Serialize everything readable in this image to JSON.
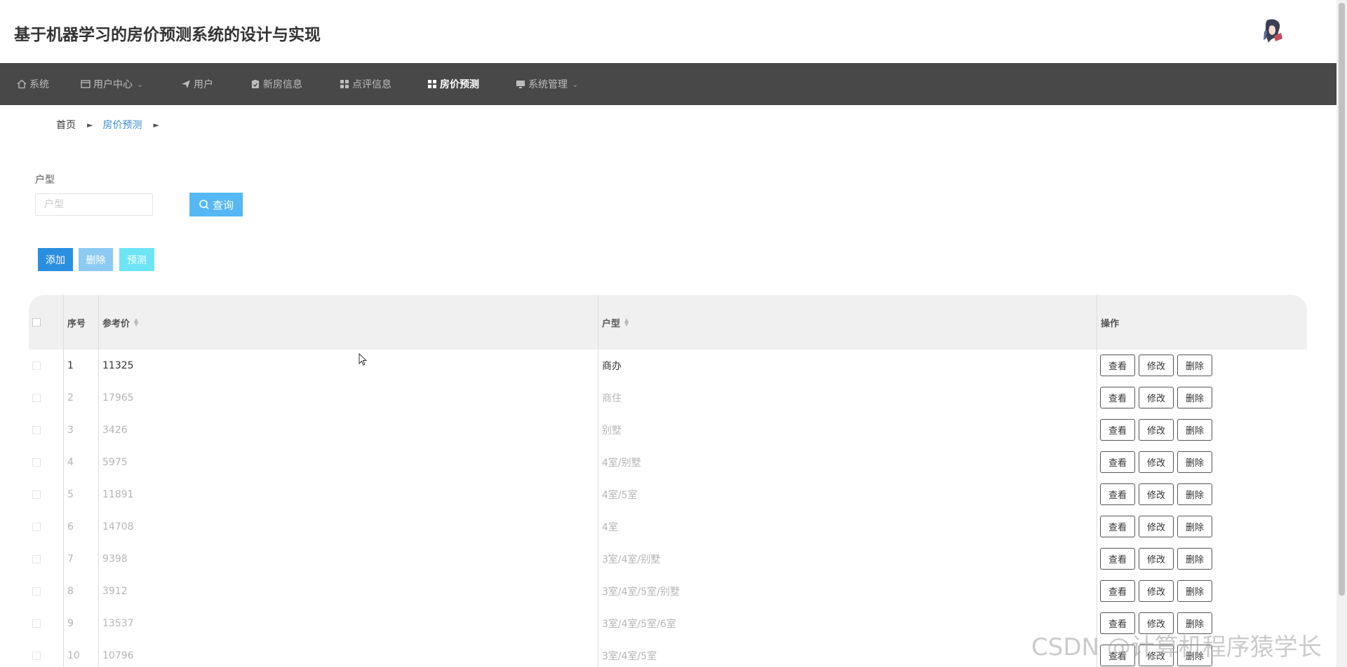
{
  "app": {
    "title": "基于机器学习的房价预测系统的设计与实现"
  },
  "nav": [
    {
      "label": "系统",
      "icon": "home-icon",
      "dropdown": false,
      "active": false
    },
    {
      "label": "用户中心",
      "icon": "window-icon",
      "dropdown": true,
      "active": false
    },
    {
      "label": "用户",
      "icon": "send-icon",
      "dropdown": false,
      "active": false
    },
    {
      "label": "新房信息",
      "icon": "clipboard-check-icon",
      "dropdown": false,
      "active": false
    },
    {
      "label": "点评信息",
      "icon": "grid-icon",
      "dropdown": false,
      "active": false
    },
    {
      "label": "房价预测",
      "icon": "grid-icon",
      "dropdown": false,
      "active": true
    },
    {
      "label": "系统管理",
      "icon": "monitor-icon",
      "dropdown": true,
      "active": false
    }
  ],
  "breadcrumb": {
    "home": "首页",
    "current": "房价预测"
  },
  "filter": {
    "label": "户型",
    "placeholder": "户型",
    "value": "",
    "query_label": "查询"
  },
  "actions": {
    "add": "添加",
    "delete": "删除",
    "predict": "预测"
  },
  "table": {
    "headers": {
      "index": "序号",
      "price": "参考价",
      "type": "户型",
      "ops": "操作"
    },
    "row_buttons": {
      "view": "查看",
      "edit": "修改",
      "delete": "删除"
    },
    "rows": [
      {
        "index": "1",
        "price": "11325",
        "type": "商办"
      },
      {
        "index": "2",
        "price": "17965",
        "type": "商住"
      },
      {
        "index": "3",
        "price": "3426",
        "type": "别墅"
      },
      {
        "index": "4",
        "price": "5975",
        "type": "4室/别墅"
      },
      {
        "index": "5",
        "price": "11891",
        "type": "4室/5室"
      },
      {
        "index": "6",
        "price": "14708",
        "type": "4室"
      },
      {
        "index": "7",
        "price": "9398",
        "type": "3室/4室/别墅"
      },
      {
        "index": "8",
        "price": "3912",
        "type": "3室/4室/5室/别墅"
      },
      {
        "index": "9",
        "price": "13537",
        "type": "3室/4室/5室/6室"
      },
      {
        "index": "10",
        "price": "10796",
        "type": "3室/4室/5室"
      }
    ]
  },
  "watermark": "CSDN @计算机程序猿学长",
  "colors": {
    "navbar": "#484848",
    "query_button": "#55b7f3",
    "add_button": "#2b8fe0",
    "delete_button": "#8ccaf2",
    "predict_button": "#6de4f6",
    "breadcrumb_active": "#3a8bd5"
  }
}
